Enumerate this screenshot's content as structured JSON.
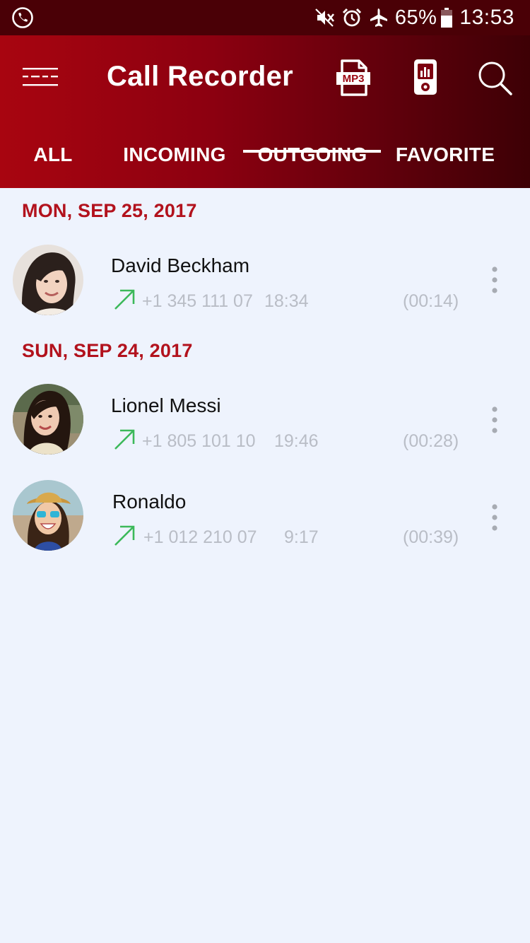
{
  "status_bar": {
    "call_icon": "phone-call-icon",
    "icons": [
      "mute-icon",
      "alarm-icon",
      "airplane-icon"
    ],
    "battery_percent": "65%",
    "clock": "13:53"
  },
  "app_bar": {
    "title": "Call Recorder",
    "menu_icon": "hamburger-menu-icon",
    "mp3_icon": "mp3-file-icon",
    "player_icon": "audio-player-icon",
    "search_icon": "search-icon"
  },
  "tabs": [
    {
      "label": "ALL",
      "selected": false
    },
    {
      "label": "INCOMING",
      "selected": false
    },
    {
      "label": "OUTGOING",
      "selected": true
    },
    {
      "label": "FAVORITE",
      "selected": false
    }
  ],
  "groups": [
    {
      "date": "MON, SEP 25, 2017",
      "calls": [
        {
          "name": "David Beckham",
          "phone": "+1 345 111 07",
          "time": "18:34",
          "duration": "(00:14)",
          "direction_icon": "outgoing-arrow-icon"
        }
      ]
    },
    {
      "date": "SUN, SEP 24, 2017",
      "calls": [
        {
          "name": "Lionel Messi",
          "phone": "+1 805 101 10",
          "time": "19:46",
          "duration": "(00:28)",
          "direction_icon": "outgoing-arrow-icon"
        },
        {
          "name": "Ronaldo",
          "phone": "+1 012 210 07",
          "time": "9:17",
          "duration": "(00:39)",
          "direction_icon": "outgoing-arrow-icon"
        }
      ]
    }
  ],
  "colors": {
    "primary": "#a80510",
    "primary_dark": "#4a0006",
    "date_header": "#b2121d",
    "outgoing_arrow": "#3cb95a",
    "background": "#eef3fd"
  }
}
